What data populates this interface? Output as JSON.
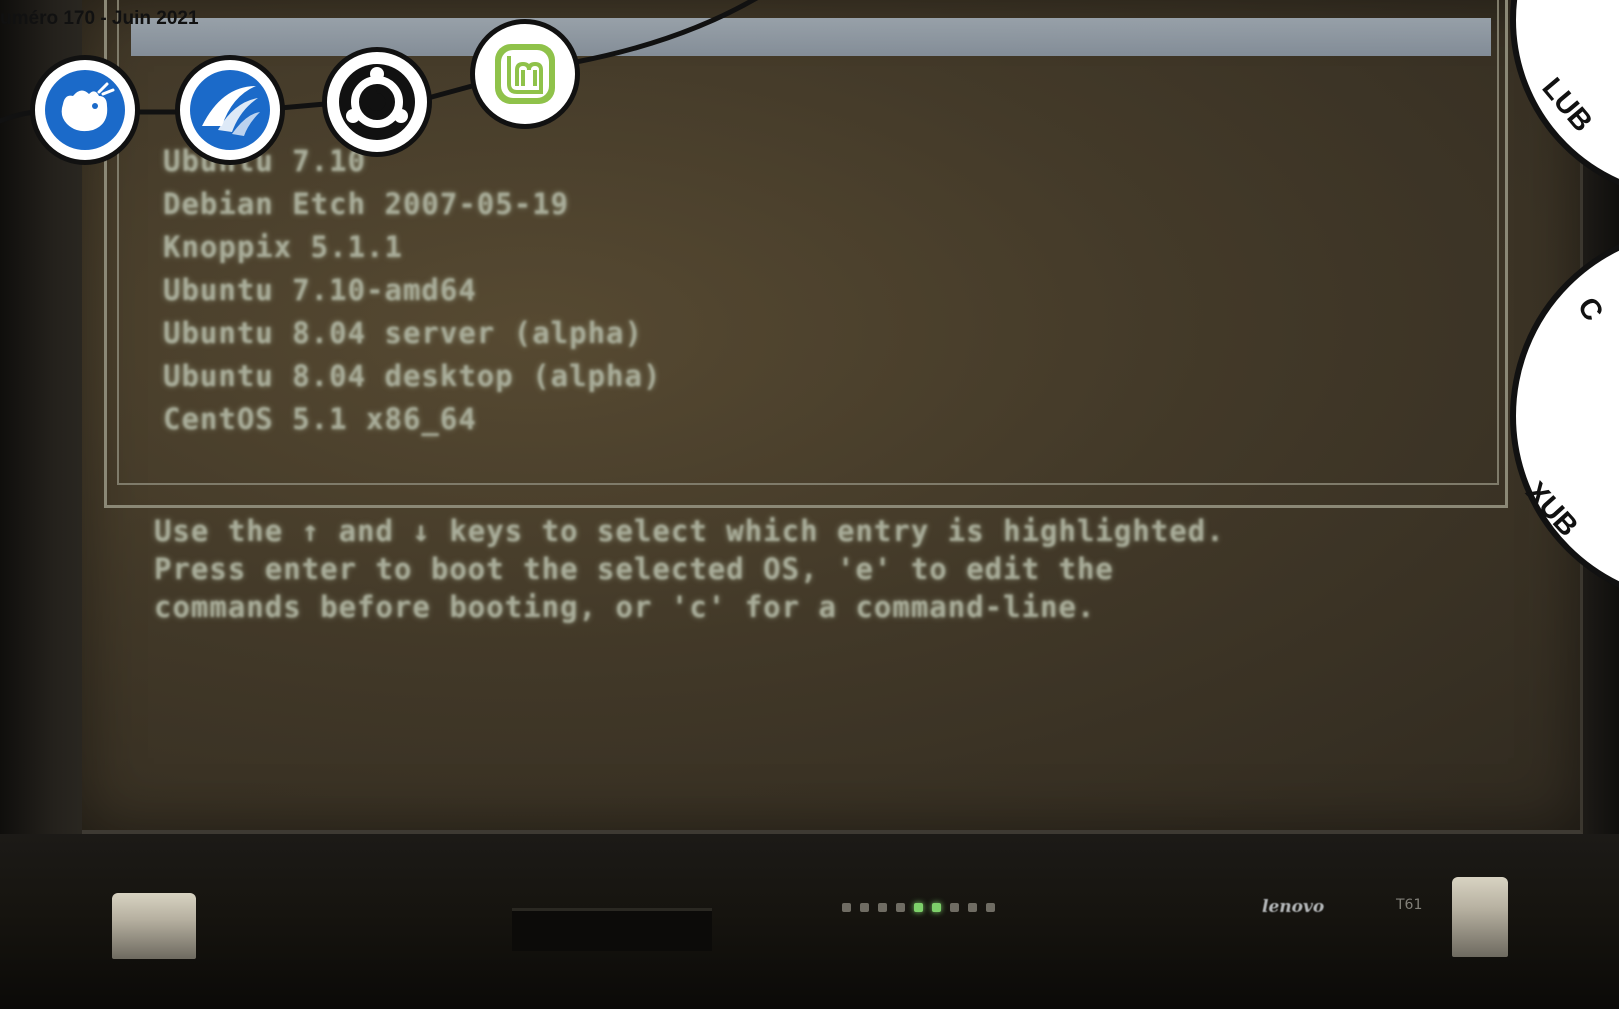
{
  "magazine": {
    "issue_label": "uméro 170 - Juin 2021",
    "side_labels": {
      "lubuntu": "LUB",
      "kubuntu": "C",
      "xubuntu": "XUB"
    },
    "logos": [
      "xfce-mouse-icon",
      "lubuntu-bird-icon",
      "ubuntu-budgie-icon",
      "linux-mint-icon"
    ],
    "colors": {
      "ink": "#111111",
      "logo_blue": "#1b6ac9",
      "mint_green": "#8fc24a"
    }
  },
  "screen": {
    "menu_entries": [
      "Ubuntu 7.10",
      "Debian Etch 2007-05-19",
      "Knoppix 5.1.1",
      "Ubuntu 7.10-amd64",
      "Ubuntu 8.04 server (alpha)",
      "Ubuntu 8.04 desktop (alpha)",
      "CentOS 5.1 x86_64"
    ],
    "help_lines": [
      "Use the ↑ and ↓ keys to select which entry is highlighted.",
      "Press enter to boot the selected OS, 'e' to edit the",
      "commands before booting, or 'c' for a command-line."
    ]
  },
  "laptop": {
    "brand": "lenovo",
    "model": "T61",
    "indicator_leds": [
      "off",
      "off",
      "off",
      "off",
      "on",
      "on",
      "off",
      "off",
      "off"
    ]
  }
}
